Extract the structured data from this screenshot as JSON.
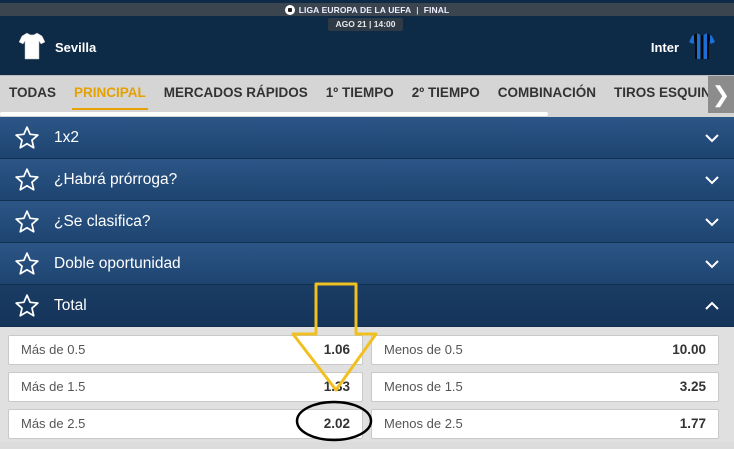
{
  "header": {
    "competition": "LIGA EUROPA DE LA UEFA",
    "stage": "FINAL",
    "separator": "|",
    "date_time": "AGO 21 | 14:00",
    "home_team": "Sevilla",
    "away_team": "Inter"
  },
  "tabs": {
    "items": [
      {
        "label": "TODAS"
      },
      {
        "label": "PRINCIPAL"
      },
      {
        "label": "MERCADOS RÁPIDOS"
      },
      {
        "label": "1º TIEMPO"
      },
      {
        "label": "2º TIEMPO"
      },
      {
        "label": "COMBINACIÓN"
      },
      {
        "label": "TIROS ESQUINA"
      }
    ],
    "active": "PRINCIPAL",
    "next_arrow": "❯"
  },
  "markets": [
    {
      "title": "1x2",
      "expanded": false
    },
    {
      "title": "¿Habrá prórroga?",
      "expanded": false
    },
    {
      "title": "¿Se clasifica?",
      "expanded": false
    },
    {
      "title": "Doble oportunidad",
      "expanded": false
    },
    {
      "title": "Total",
      "expanded": true
    }
  ],
  "total_outcomes": [
    {
      "over_label": "Más de 0.5",
      "over_price": "1.06",
      "under_label": "Menos de 0.5",
      "under_price": "10.00"
    },
    {
      "over_label": "Más de 1.5",
      "over_price": "1.33",
      "under_label": "Menos de 1.5",
      "under_price": "3.25"
    },
    {
      "over_label": "Más de 2.5",
      "over_price": "2.02",
      "under_label": "Menos de 2.5",
      "under_price": "1.77"
    }
  ],
  "colors": {
    "header_bg": "#0d2a47",
    "market_bar": "#2c5687",
    "active_tab": "#e6a100",
    "annotation_arrow": "#f0c020",
    "annotation_circle": "#000000"
  }
}
